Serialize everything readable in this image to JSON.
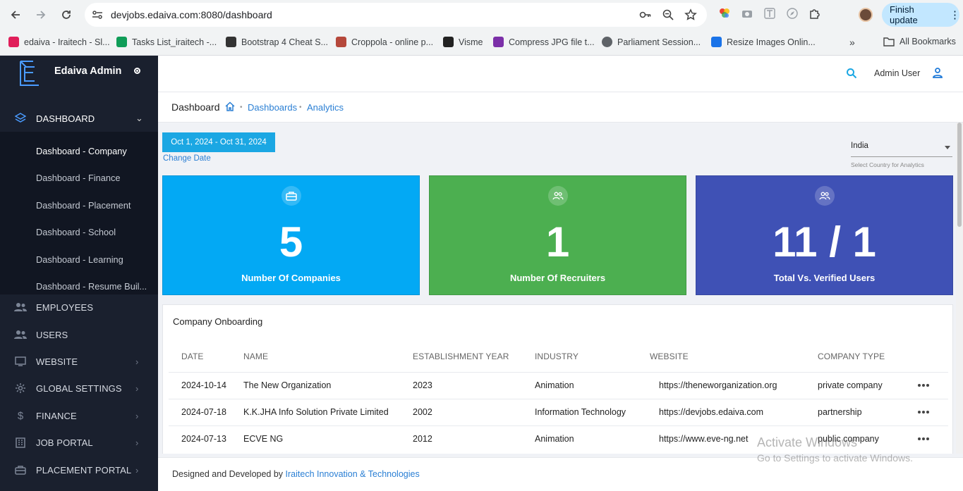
{
  "browser": {
    "url": "devjobs.edaiva.com:8080/dashboard",
    "finish_update": "Finish update",
    "bookmarks": [
      {
        "label": "edaiva - Iraitech - Sl...",
        "color": "#e01e5a"
      },
      {
        "label": "Tasks List_iraitech -...",
        "color": "#0f9d58"
      },
      {
        "label": "Bootstrap 4 Cheat S...",
        "color": "#333333"
      },
      {
        "label": "Croppola - online p...",
        "color": "#b5483b"
      },
      {
        "label": "Visme",
        "color": "#222222"
      },
      {
        "label": "Compress JPG file t...",
        "color": "#7b2fa8"
      },
      {
        "label": "Parliament Session...",
        "color": "#5f6368"
      },
      {
        "label": "Resize Images Onlin...",
        "color": "#1a73e8"
      }
    ],
    "all_bookmarks": "All Bookmarks"
  },
  "sidebar": {
    "brand": "Edaiva Admin",
    "dashboard_label": "DASHBOARD",
    "sub_items": [
      "Dashboard - Company",
      "Dashboard - Finance",
      "Dashboard - Placement",
      "Dashboard - School",
      "Dashboard - Learning",
      "Dashboard - Resume Buil..."
    ],
    "items": [
      {
        "label": "EMPLOYEES",
        "icon": "people-icon"
      },
      {
        "label": "USERS",
        "icon": "people-icon"
      },
      {
        "label": "WEBSITE",
        "icon": "monitor-icon"
      },
      {
        "label": "GLOBAL SETTINGS",
        "icon": "gear-icon"
      },
      {
        "label": "FINANCE",
        "icon": "dollar-icon"
      },
      {
        "label": "JOB PORTAL",
        "icon": "building-icon"
      },
      {
        "label": "PLACEMENT PORTAL",
        "icon": "briefcase-icon"
      }
    ]
  },
  "header": {
    "user_name": "Admin User"
  },
  "breadcrumb": {
    "title": "Dashboard",
    "links": [
      "Dashboards",
      "Analytics"
    ]
  },
  "filters": {
    "date_range": "Oct 1, 2024 - Oct 31, 2024",
    "change_date": "Change Date",
    "country": "India",
    "country_hint": "Select Country for Analytics"
  },
  "stats": [
    {
      "value": "5",
      "caption": "Number Of Companies",
      "color": "#03a9f4",
      "icon": "briefcase-icon"
    },
    {
      "value": "1",
      "caption": "Number Of Recruiters",
      "color": "#4caf50",
      "icon": "people-icon"
    },
    {
      "value": "11 / 1",
      "caption": "Total Vs. Verified Users",
      "color": "#3f51b5",
      "icon": "people-icon"
    }
  ],
  "onboarding": {
    "title": "Company Onboarding",
    "columns": [
      "DATE",
      "NAME",
      "ESTABLISHMENT YEAR",
      "INDUSTRY",
      "WEBSITE",
      "COMPANY TYPE"
    ],
    "rows": [
      [
        "2024-10-14",
        "The New Organization",
        "2023",
        "Animation",
        "https://theneworganization.org",
        "private company"
      ],
      [
        "2024-07-18",
        "K.K.JHA Info Solution Private Limited",
        "2002",
        "Information Technology",
        "https://devjobs.edaiva.com",
        "partnership"
      ],
      [
        "2024-07-13",
        "ECVE NG",
        "2012",
        "Animation",
        "https://www.eve-ng.net",
        "public company"
      ]
    ]
  },
  "footer": {
    "prefix": "Designed and Developed by",
    "company": "Iraitech Innovation & Technologies"
  },
  "watermark": {
    "line1": "Activate Windows",
    "line2": "Go to Settings to activate Windows."
  }
}
